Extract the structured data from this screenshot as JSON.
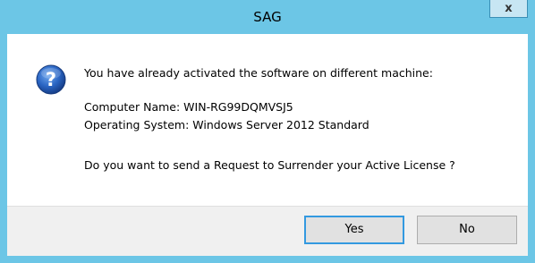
{
  "window": {
    "title": "SAG",
    "close_label": "x"
  },
  "message": {
    "line1": "You have already activated the software on different machine:",
    "line2": "Computer Name: WIN-RG99DQMVSJ5",
    "line3": "Operating System: Windows Server 2012 Standard",
    "line4": "Do you want to send a Request to Surrender your Active License ?"
  },
  "buttons": {
    "yes_label": "Yes",
    "no_label": "No"
  },
  "icon": "question-icon",
  "colors": {
    "frame": "#6cc6e6",
    "icon_blue": "#2a65c3",
    "default_button_border": "#3399e0"
  }
}
